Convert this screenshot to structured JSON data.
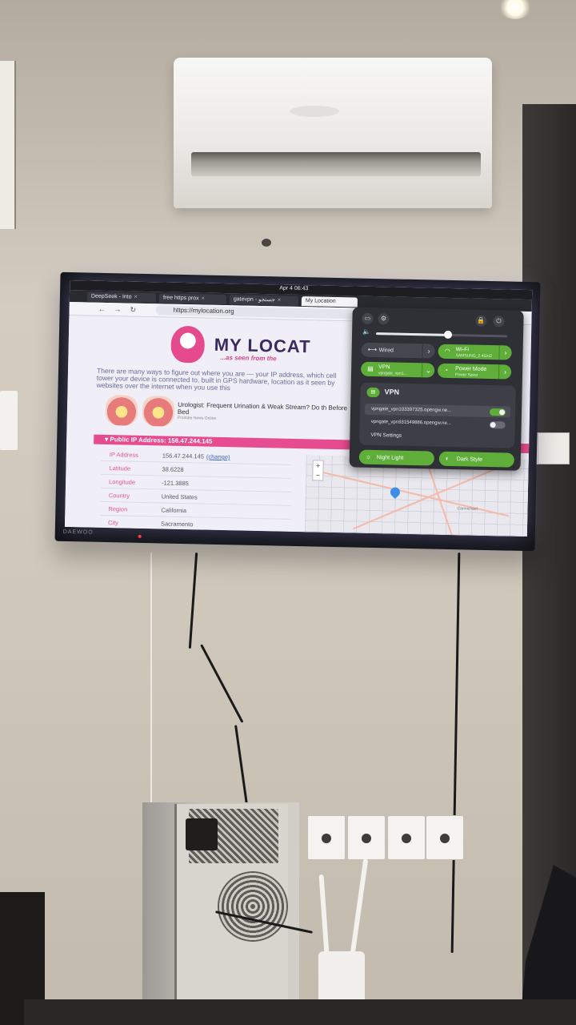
{
  "tabs": [
    {
      "label": "DeepSeek - Into"
    },
    {
      "label": "free https prox"
    },
    {
      "label": "gatevpn - جستجو"
    },
    {
      "label": "My Location"
    }
  ],
  "tab_close_glyph": "×",
  "topbar": {
    "datetime": "Apr 4 06:43"
  },
  "browser": {
    "url": "https://mylocation.org"
  },
  "site": {
    "logo_text": "MY LOCAT",
    "tagline": "...as seen from the",
    "intro": "There are many ways to figure out where you are — your IP address, which cell tower your device is connected to, built in GPS hardware, location as it seen by websites over the internet when you use this"
  },
  "ad": {
    "title": "Urologist: Frequent Urination & Weak Stream? Do th Before Bed",
    "source": "Prostate News Online"
  },
  "ip_banner": "▾ Public IP Address: 156.47.244.145",
  "ip_info": {
    "rows": [
      {
        "label": "IP Address",
        "value": "156.47.244.145"
      },
      {
        "label": "Latitude",
        "value": "38.6228"
      },
      {
        "label": "Longitude",
        "value": "-121.3885"
      },
      {
        "label": "Country",
        "value": "United States"
      },
      {
        "label": "Region",
        "value": "California"
      },
      {
        "label": "City",
        "value": "Sacramento"
      }
    ],
    "change_link": "(change)"
  },
  "map": {
    "zoom_in": "+",
    "zoom_out": "−",
    "town_label": "Carmichael"
  },
  "quick_settings": {
    "wired": {
      "title": "Wired"
    },
    "wifi": {
      "title": "Wi-Fi",
      "subtitle": "SAMSUNG_2.4GHZ"
    },
    "vpn_pill": {
      "title": "VPN",
      "subtitle": "vpngate_vpn1..."
    },
    "power": {
      "title": "Power Mode",
      "subtitle": "Power Saver"
    },
    "vpn_menu": {
      "title": "VPN",
      "connections": [
        {
          "name": "vpngate_vpn103397325.opengw.ne...",
          "enabled": true
        },
        {
          "name": "vpngate_vpn931549886.opengw.ne...",
          "enabled": false
        }
      ],
      "settings_label": "VPN Settings"
    },
    "night_light": "Night Light",
    "dark_style": "Dark Style",
    "volume_level": 0.55
  },
  "tv_brand": "DAEWOO",
  "colors": {
    "accent_green": "#5fae3a",
    "site_pink": "#e64c8f",
    "panel_bg": "#2f2f36"
  }
}
